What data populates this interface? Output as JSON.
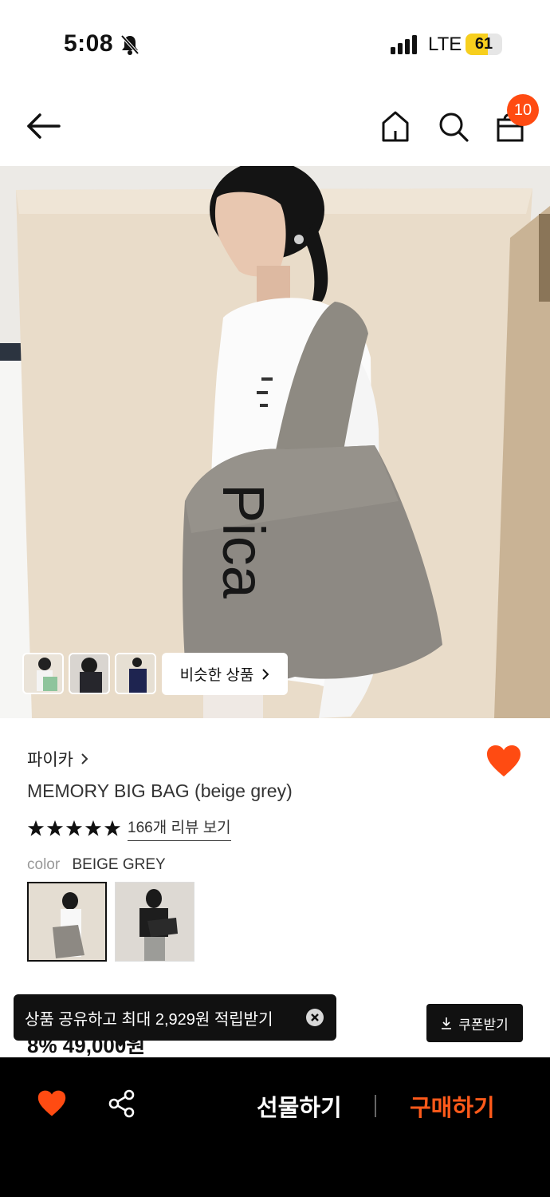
{
  "status_bar": {
    "time": "5:08",
    "network": "LTE",
    "battery": "61",
    "battery_level": 0.61
  },
  "nav": {
    "cart_count": "10"
  },
  "gallery": {
    "similar_label": "비슷한 상품"
  },
  "product": {
    "brand": "파이카",
    "title": "MEMORY BIG BAG (beige grey)",
    "rating_stars": 5,
    "review_link": "166개 리뷰 보기",
    "color_label": "color",
    "color_value": "BEIGE GREY",
    "bag_logo": "Pica",
    "price_peek": "8%  49,000원"
  },
  "share_tooltip": {
    "text": "상품 공유하고 최대 2,929원 적립받기"
  },
  "coupon": {
    "label": "쿠폰받기"
  },
  "bottom_bar": {
    "gift_label": "선물하기",
    "buy_label": "구매하기"
  },
  "colors": {
    "accent": "#ff4b12",
    "buy": "#ff5a1a",
    "bar_bg": "#000000"
  }
}
